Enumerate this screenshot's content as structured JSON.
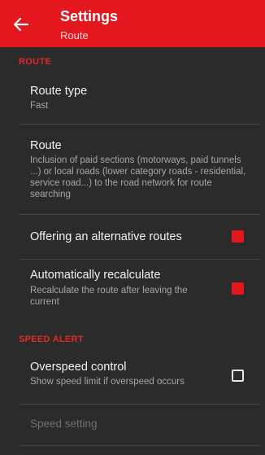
{
  "header": {
    "title": "Settings",
    "subtitle": "Route"
  },
  "sections": {
    "route_header": "ROUTE",
    "speed_header": "SPEED ALERT"
  },
  "route_type": {
    "label": "Route type",
    "value": "Fast"
  },
  "route": {
    "label": "Route",
    "description": "Inclusion of paid sections (motorways, paid tunnels ...) or local roads (lower category roads - residential, service road...) to the road network for route searching"
  },
  "alt_routes": {
    "label": "Offering an alternative routes",
    "checked": true
  },
  "recalc": {
    "label": "Automatically recalculate",
    "description": "Recalculate the route after leaving the current",
    "checked": true
  },
  "overspeed": {
    "label": "Overspeed control",
    "description": "Show speed limit if overspeed occurs",
    "checked": false
  },
  "speed_setting": {
    "label": "Speed setting",
    "enabled": false
  },
  "colors": {
    "accent": "#e4161e",
    "background": "#2b2b2b"
  }
}
